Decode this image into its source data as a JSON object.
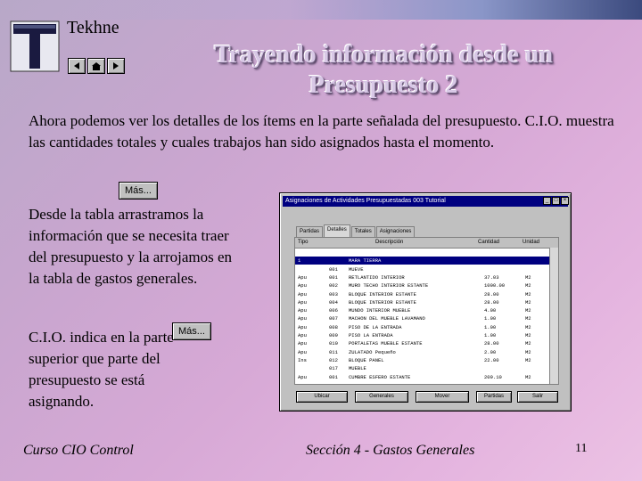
{
  "brand": "Tekhne",
  "logo_letter": "T",
  "title_line1": "Trayendo información desde un",
  "title_line2": "Presupuesto 2",
  "paragraph1": "Ahora podemos ver los detalles de los ítems en la parte señalada del presupuesto. C.I.O. muestra las cantidades totales y cuales trabajos han sido asignados hasta el momento.",
  "paragraph2": "Desde la tabla arrastramos la información que se necesita traer del presupuesto y la arrojamos en la tabla de gastos generales.",
  "paragraph3": "C.I.O. indica en la parte superior que parte del presupuesto se está asignando.",
  "mas_label_1": "Más...",
  "mas_label_2": "Más...",
  "footer_left": "Curso CIO Control",
  "footer_mid": "Sección 4 - Gastos Generales",
  "page_number": "11",
  "window": {
    "title": "Asignaciones de Actividades Presupuestadas 003 Tutorial",
    "tabs": [
      "Partidas",
      "Detalles",
      "Totales",
      "Asignaciones"
    ],
    "active_tab": 1,
    "columns": [
      "Tipo",
      "Descripción",
      "Cantidad",
      "Unidad"
    ],
    "rows": [
      {
        "tipo": "",
        "cod": "",
        "desc": "",
        "cant": "",
        "unit": ""
      },
      {
        "tipo": "1",
        "cod": "",
        "desc": "MARA TIERRA",
        "cant": "",
        "unit": "",
        "selected": true
      },
      {
        "tipo": "",
        "cod": "001",
        "desc": "MUEVE",
        "cant": "",
        "unit": ""
      },
      {
        "tipo": "Apu",
        "cod": "001",
        "desc": "RETLANTIDO INTERIOR",
        "cant": "37.03",
        "unit": "M2"
      },
      {
        "tipo": "Apu",
        "cod": "002",
        "desc": "MURO TECHO INTERIOR ESTANTE",
        "cant": "1000.00",
        "unit": "M2"
      },
      {
        "tipo": "Apu",
        "cod": "003",
        "desc": "BLOQUE INTERIOR ESTANTE",
        "cant": "28.00",
        "unit": "M2"
      },
      {
        "tipo": "Apu",
        "cod": "004",
        "desc": "BLOQUE INTERIOR ESTANTE",
        "cant": "28.00",
        "unit": "M2"
      },
      {
        "tipo": "Apu",
        "cod": "006",
        "desc": "MUNDO INTERIOR MUEBLE",
        "cant": "4.00",
        "unit": "M2"
      },
      {
        "tipo": "Apu",
        "cod": "007",
        "desc": "MACHON DEL MUEBLE LAVAMANO",
        "cant": "1.00",
        "unit": "M2"
      },
      {
        "tipo": "Apu",
        "cod": "008",
        "desc": "PISO DE LA ENTRADA",
        "cant": "1.00",
        "unit": "M2"
      },
      {
        "tipo": "Apu",
        "cod": "009",
        "desc": "PISO LA ENTRADA",
        "cant": "1.00",
        "unit": "M2"
      },
      {
        "tipo": "Apu",
        "cod": "010",
        "desc": "PORTALETAS MUEBLE ESTANTE",
        "cant": "28.00",
        "unit": "M2"
      },
      {
        "tipo": "Apu",
        "cod": "011",
        "desc": "ZULATADO Pequeño",
        "cant": "2.00",
        "unit": "M2"
      },
      {
        "tipo": "Ins",
        "cod": "012",
        "desc": "BLOQUE PANEL",
        "cant": "22.00",
        "unit": "M2"
      },
      {
        "tipo": "",
        "cod": "017",
        "desc": "MUEBLE",
        "cant": "",
        "unit": ""
      },
      {
        "tipo": "Apu",
        "cod": "001",
        "desc": "CUMBRE ESFERO ESTANTE",
        "cant": "209.10",
        "unit": "M2"
      }
    ],
    "buttons": [
      "Ubicar",
      "Generales",
      "Mover",
      "Partidas",
      "Salir"
    ]
  }
}
